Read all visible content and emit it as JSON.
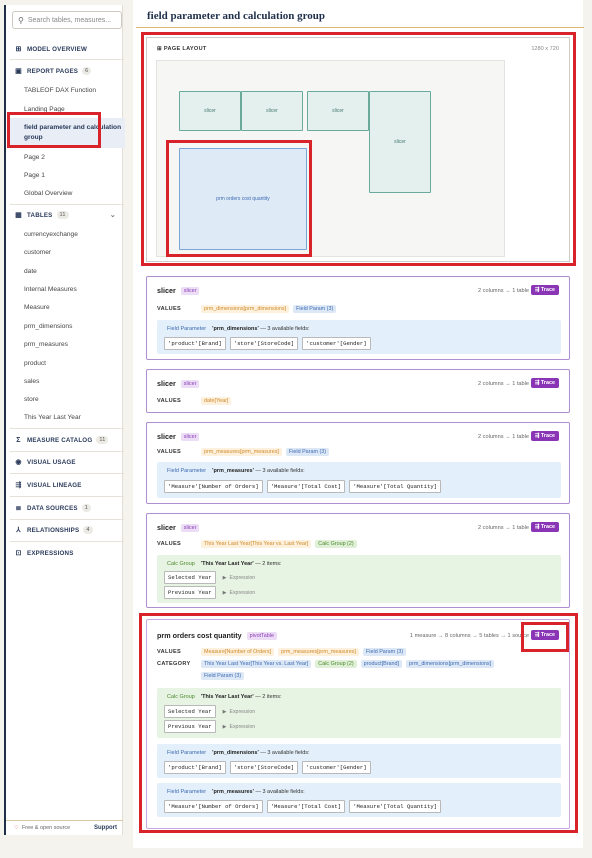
{
  "sidebar": {
    "search_placeholder": "Search tables, measures...",
    "model_overview": "MODEL OVERVIEW",
    "report_pages": {
      "label": "REPORT PAGES",
      "count": "6",
      "items": [
        "TABLEOF DAX Function",
        "Landing Page",
        "field parameter and calculation group",
        "Page 2",
        "Page 1",
        "Global Overview"
      ]
    },
    "tables": {
      "label": "TABLES",
      "count": "11",
      "items": [
        "currencyexchange",
        "customer",
        "date",
        "Internal Measures",
        "Measure",
        "prm_dimensions",
        "prm_measures",
        "product",
        "sales",
        "store",
        "This Year Last Year"
      ]
    },
    "measure_catalog": {
      "label": "MEASURE CATALOG",
      "count": "11"
    },
    "visual_usage": "VISUAL USAGE",
    "visual_lineage": "VISUAL LINEAGE",
    "data_sources": {
      "label": "DATA SOURCES",
      "count": "1"
    },
    "relationships": {
      "label": "RELATIONSHIPS",
      "count": "4"
    },
    "expressions": "EXPRESSIONS",
    "footer_left": "Free & open source",
    "footer_right": "Support"
  },
  "page_title": "field parameter and calculation group",
  "page_layout": {
    "label": "PAGE LAYOUT",
    "dimensions": "1280 x 720",
    "visuals": [
      "slicer",
      "slicer",
      "slicer",
      "slicer",
      "prm orders cost quantity"
    ]
  },
  "cards": [
    {
      "name": "slicer",
      "type": "slicer",
      "meta": "2 columns → 1 table",
      "trace": "Trace",
      "values_label": "VALUES",
      "values": [
        "prm_dimensions[prm_dimensions]"
      ],
      "values_tag": "Field Param (3)",
      "panel": {
        "kind": "Field Parameter",
        "name": "'prm_dimensions'",
        "desc": "— 3 available fields:",
        "fields": [
          "'product'[Brand]",
          "'store'[StoreCode]",
          "'customer'[Gender]"
        ]
      }
    },
    {
      "name": "slicer",
      "type": "slicer",
      "meta": "2 columns → 1 table",
      "trace": "Trace",
      "values_label": "VALUES",
      "values": [
        "date[Year]"
      ]
    },
    {
      "name": "slicer",
      "type": "slicer",
      "meta": "2 columns → 1 table",
      "trace": "Trace",
      "values_label": "VALUES",
      "values": [
        "prm_measures[prm_measures]"
      ],
      "values_tag": "Field Param (3)",
      "panel": {
        "kind": "Field Parameter",
        "name": "'prm_measures'",
        "desc": "— 3 available fields:",
        "fields": [
          "'Measure'[Number of Orders]",
          "'Measure'[Total Cost]",
          "'Measure'[Total Quantity]"
        ]
      }
    },
    {
      "name": "slicer",
      "type": "slicer",
      "meta": "2 columns → 1 table",
      "trace": "Trace",
      "values_label": "VALUES",
      "values": [
        "This Year Last Year[This Year vs. Last Year]"
      ],
      "values_tag": "Calc Group (2)",
      "panel": {
        "kind": "Calc Group",
        "name": "'This Year Last Year'",
        "desc": "— 2 items:",
        "items": [
          "Selected Year",
          "Previous Year"
        ],
        "item_note": "Expression"
      }
    }
  ],
  "pivot": {
    "name": "prm orders cost quantity",
    "type": "pivotTable",
    "meta": "1 measure → 8 columns → 5 tables → 1 source",
    "trace": "Trace",
    "values_label": "VALUES",
    "values": [
      "Measure[Number of Orders]",
      "prm_measures[prm_measures]"
    ],
    "values_tag": "Field Param (3)",
    "category_label": "CATEGORY",
    "category": [
      "This Year Last Year[This Year vs. Last Year]"
    ],
    "category_tag1": "Calc Group (2)",
    "category2": [
      "product[Brand]",
      "prm_dimensions[prm_dimensions]"
    ],
    "category_tag2": "Field Param (3)",
    "cg": {
      "kind": "Calc Group",
      "name": "'This Year Last Year'",
      "desc": "— 2 items:",
      "items": [
        "Selected Year",
        "Previous Year"
      ],
      "item_note": "Expression"
    },
    "fp1": {
      "kind": "Field Parameter",
      "name": "'prm_dimensions'",
      "desc": "— 3 available fields:",
      "fields": [
        "'product'[Brand]",
        "'store'[StoreCode]",
        "'customer'[Gender]"
      ]
    },
    "fp2": {
      "kind": "Field Parameter",
      "name": "'prm_measures'",
      "desc": "— 3 available fields:",
      "fields": [
        "'Measure'[Number of Orders]",
        "'Measure'[Total Cost]",
        "'Measure'[Total Quantity]"
      ]
    }
  },
  "colors": {
    "accent": "#8a35b5",
    "highlight": "#d8232a",
    "nav": "#1f2f4a"
  }
}
